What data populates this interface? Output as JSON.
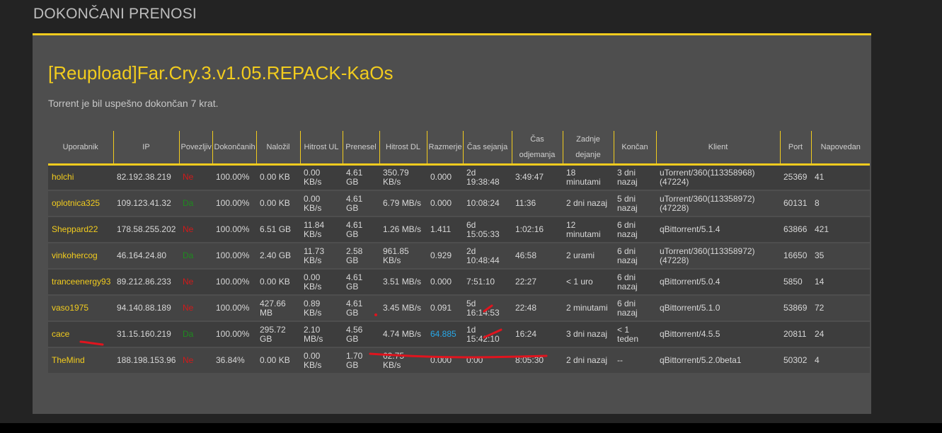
{
  "section_title": "DOKONČANI PRENOSI",
  "torrent": {
    "title": "[Reupload]Far.Cry.3.v1.05.REPACK-KaOs",
    "completed_note": "Torrent je bil uspešno dokončan 7 krat."
  },
  "columns": [
    {
      "label": "Uporabnik"
    },
    {
      "label": "IP"
    },
    {
      "label": "Povezljiv"
    },
    {
      "label": "Dokončanih"
    },
    {
      "label": "Naložil"
    },
    {
      "label": "Hitrost UL"
    },
    {
      "label": "Prenesel"
    },
    {
      "label": "Hitrost DL"
    },
    {
      "label": "Razmerje"
    },
    {
      "label": "Čas sejanja"
    },
    {
      "label": "Čas odjemanja"
    },
    {
      "label": "Zadnje dejanje"
    },
    {
      "label": "Končan"
    },
    {
      "label": "Klient"
    },
    {
      "label": "Port"
    },
    {
      "label": "Napovedan"
    }
  ],
  "rows": [
    {
      "user": "holchi",
      "ip": "82.192.38.219",
      "conn": "Ne",
      "conn_ok": false,
      "done": "100.00%",
      "uploaded": "0.00 KB",
      "ul_speed": "0.00 KB/s",
      "downloaded": "4.61 GB",
      "dl_speed": "350.79 KB/s",
      "ratio": "0.000",
      "seed_time": "2d 19:38:48",
      "leech_time": "3:49:47",
      "last_action": "18 minutami",
      "finished": "3 dni nazaj",
      "client": "uTorrent/360(113358968)(47224)",
      "port": "25369",
      "announced": "41"
    },
    {
      "user": "oplotnica325",
      "ip": "109.123.41.32",
      "conn": "Da",
      "conn_ok": true,
      "done": "100.00%",
      "uploaded": "0.00 KB",
      "ul_speed": "0.00 KB/s",
      "downloaded": "4.61 GB",
      "dl_speed": "6.79 MB/s",
      "ratio": "0.000",
      "seed_time": "10:08:24",
      "leech_time": "11:36",
      "last_action": "2 dni nazaj",
      "finished": "5 dni nazaj",
      "client": "uTorrent/360(113358972)(47228)",
      "port": "60131",
      "announced": "8"
    },
    {
      "user": "Sheppard22",
      "ip": "178.58.255.202",
      "conn": "Ne",
      "conn_ok": false,
      "done": "100.00%",
      "uploaded": "6.51 GB",
      "ul_speed": "11.84 KB/s",
      "downloaded": "4.61 GB",
      "dl_speed": "1.26 MB/s",
      "ratio": "1.411",
      "seed_time": "6d 15:05:33",
      "leech_time": "1:02:16",
      "last_action": "12 minutami",
      "finished": "6 dni nazaj",
      "client": "qBittorrent/5.1.4",
      "port": "63866",
      "announced": "421"
    },
    {
      "user": "vinkohercog",
      "ip": "46.164.24.80",
      "conn": "Da",
      "conn_ok": true,
      "done": "100.00%",
      "uploaded": "2.40 GB",
      "ul_speed": "11.73 KB/s",
      "downloaded": "2.58 GB",
      "dl_speed": "961.85 KB/s",
      "ratio": "0.929",
      "seed_time": "2d 10:48:44",
      "leech_time": "46:58",
      "last_action": "2 urami",
      "finished": "6 dni nazaj",
      "client": "uTorrent/360(113358972)(47228)",
      "port": "16650",
      "announced": "35"
    },
    {
      "user": "tranceenergy93",
      "ip": "89.212.86.233",
      "conn": "Ne",
      "conn_ok": false,
      "done": "100.00%",
      "uploaded": "0.00 KB",
      "ul_speed": "0.00 KB/s",
      "downloaded": "4.61 GB",
      "dl_speed": "3.51 MB/s",
      "ratio": "0.000",
      "seed_time": "7:51:10",
      "leech_time": "22:27",
      "last_action": "< 1 uro",
      "finished": "6 dni nazaj",
      "client": "qBittorrent/5.0.4",
      "port": "5850",
      "announced": "14"
    },
    {
      "user": "vaso1975",
      "ip": "94.140.88.189",
      "conn": "Ne",
      "conn_ok": false,
      "done": "100.00%",
      "uploaded": "427.66 MB",
      "ul_speed": "0.89 KB/s",
      "downloaded": "4.61 GB",
      "dl_speed": "3.45 MB/s",
      "ratio": "0.091",
      "seed_time": "5d 16:14:53",
      "leech_time": "22:48",
      "last_action": "2 minutami",
      "finished": "6 dni nazaj",
      "client": "qBittorrent/5.1.0",
      "port": "53869",
      "announced": "72"
    },
    {
      "user": "cace",
      "ip": "31.15.160.219",
      "conn": "Da",
      "conn_ok": true,
      "done": "100.00%",
      "uploaded": "295.72 GB",
      "ul_speed": "2.10 MB/s",
      "downloaded": "4.56 GB",
      "dl_speed": "4.74 MB/s",
      "ratio": "64.885",
      "ratio_highlight": true,
      "seed_time": "1d 15:42:10",
      "leech_time": "16:24",
      "last_action": "3 dni nazaj",
      "finished": "< 1 teden",
      "client": "qBittorrent/4.5.5",
      "port": "20811",
      "announced": "24"
    },
    {
      "user": "TheMind",
      "ip": "188.198.153.96",
      "conn": "Ne",
      "conn_ok": false,
      "done": "36.84%",
      "uploaded": "0.00 KB",
      "ul_speed": "0.00 KB/s",
      "downloaded": "1.70 GB",
      "dl_speed": "62.75 KB/s",
      "ratio": "0.000",
      "seed_time": "0:00",
      "leech_time": "8:05:30",
      "last_action": "2 dni nazaj",
      "finished": "--",
      "client": "qBittorrent/5.2.0beta1",
      "port": "50302",
      "announced": "4"
    }
  ],
  "colors": {
    "accent": "#f2cc1e",
    "panel": "#4e4e4e",
    "row_dark": "#3d3d3d",
    "row_light": "#444444",
    "connectable_no": "#d11a1a",
    "connectable_yes": "#1e8c1e",
    "ratio_highlight": "#28a8e8",
    "annotation": "#e0141e"
  }
}
